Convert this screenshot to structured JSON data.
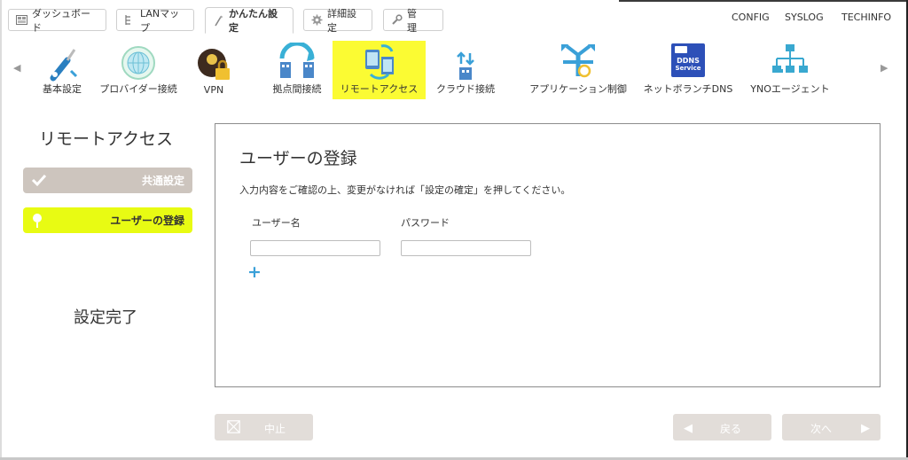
{
  "tabs": [
    {
      "label": "ダッシュボード",
      "icon": "dashboard-icon"
    },
    {
      "label": "LANマップ",
      "icon": "lan-map-icon"
    },
    {
      "label": "かんたん設定",
      "icon": "wand-icon",
      "active": true
    },
    {
      "label": "詳細設定",
      "icon": "gear-icon"
    },
    {
      "label": "管　理",
      "icon": "wrench-icon"
    }
  ],
  "top_links": [
    "CONFIG",
    "SYSLOG",
    "TECHINFO"
  ],
  "nav": {
    "items": [
      {
        "label": "基本設定",
        "icon": "screwdriver-icon"
      },
      {
        "label": "プロバイダー接続",
        "icon": "globe-icon"
      },
      {
        "label": "VPN",
        "icon": "vpn-lock-icon"
      },
      {
        "label": "拠点間接続",
        "icon": "site-link-icon"
      },
      {
        "label": "リモートアクセス",
        "icon": "remote-access-icon",
        "active": true
      },
      {
        "label": "クラウド接続",
        "icon": "cloud-connect-icon"
      },
      {
        "label": "アプリケーション制御",
        "icon": "app-control-icon"
      },
      {
        "label": "ネットボランチDNS",
        "icon": "ddns-icon"
      },
      {
        "label": "YNOエージェント",
        "icon": "yno-agent-icon"
      }
    ],
    "ddns_logo_text": [
      "DDNS",
      "Service"
    ],
    "prev_arrow": "◀",
    "next_arrow": "▶"
  },
  "sidebar": {
    "title": "リモートアクセス",
    "steps": [
      {
        "label": "共通設定",
        "state": "done"
      },
      {
        "label": "ユーザーの登録",
        "state": "current"
      }
    ],
    "complete_label": "設定完了"
  },
  "main": {
    "title": "ユーザーの登録",
    "instruction": "入力内容をご確認の上、変更がなければ「設定の確定」を押してください。",
    "columns": {
      "user": "ユーザー名",
      "password": "パスワード"
    },
    "user_value": "",
    "password_value": "",
    "add_label": "+"
  },
  "buttons": {
    "cancel": "中止",
    "back": "戻る",
    "next": "次へ",
    "back_arrow": "◀",
    "next_arrow": "▶"
  },
  "colors": {
    "active_nav": "#fbfb33",
    "current_step": "#e8fb13",
    "done_step": "#cdc5be",
    "button_bg": "#e2ddd9",
    "plus": "#3aa0d8"
  }
}
